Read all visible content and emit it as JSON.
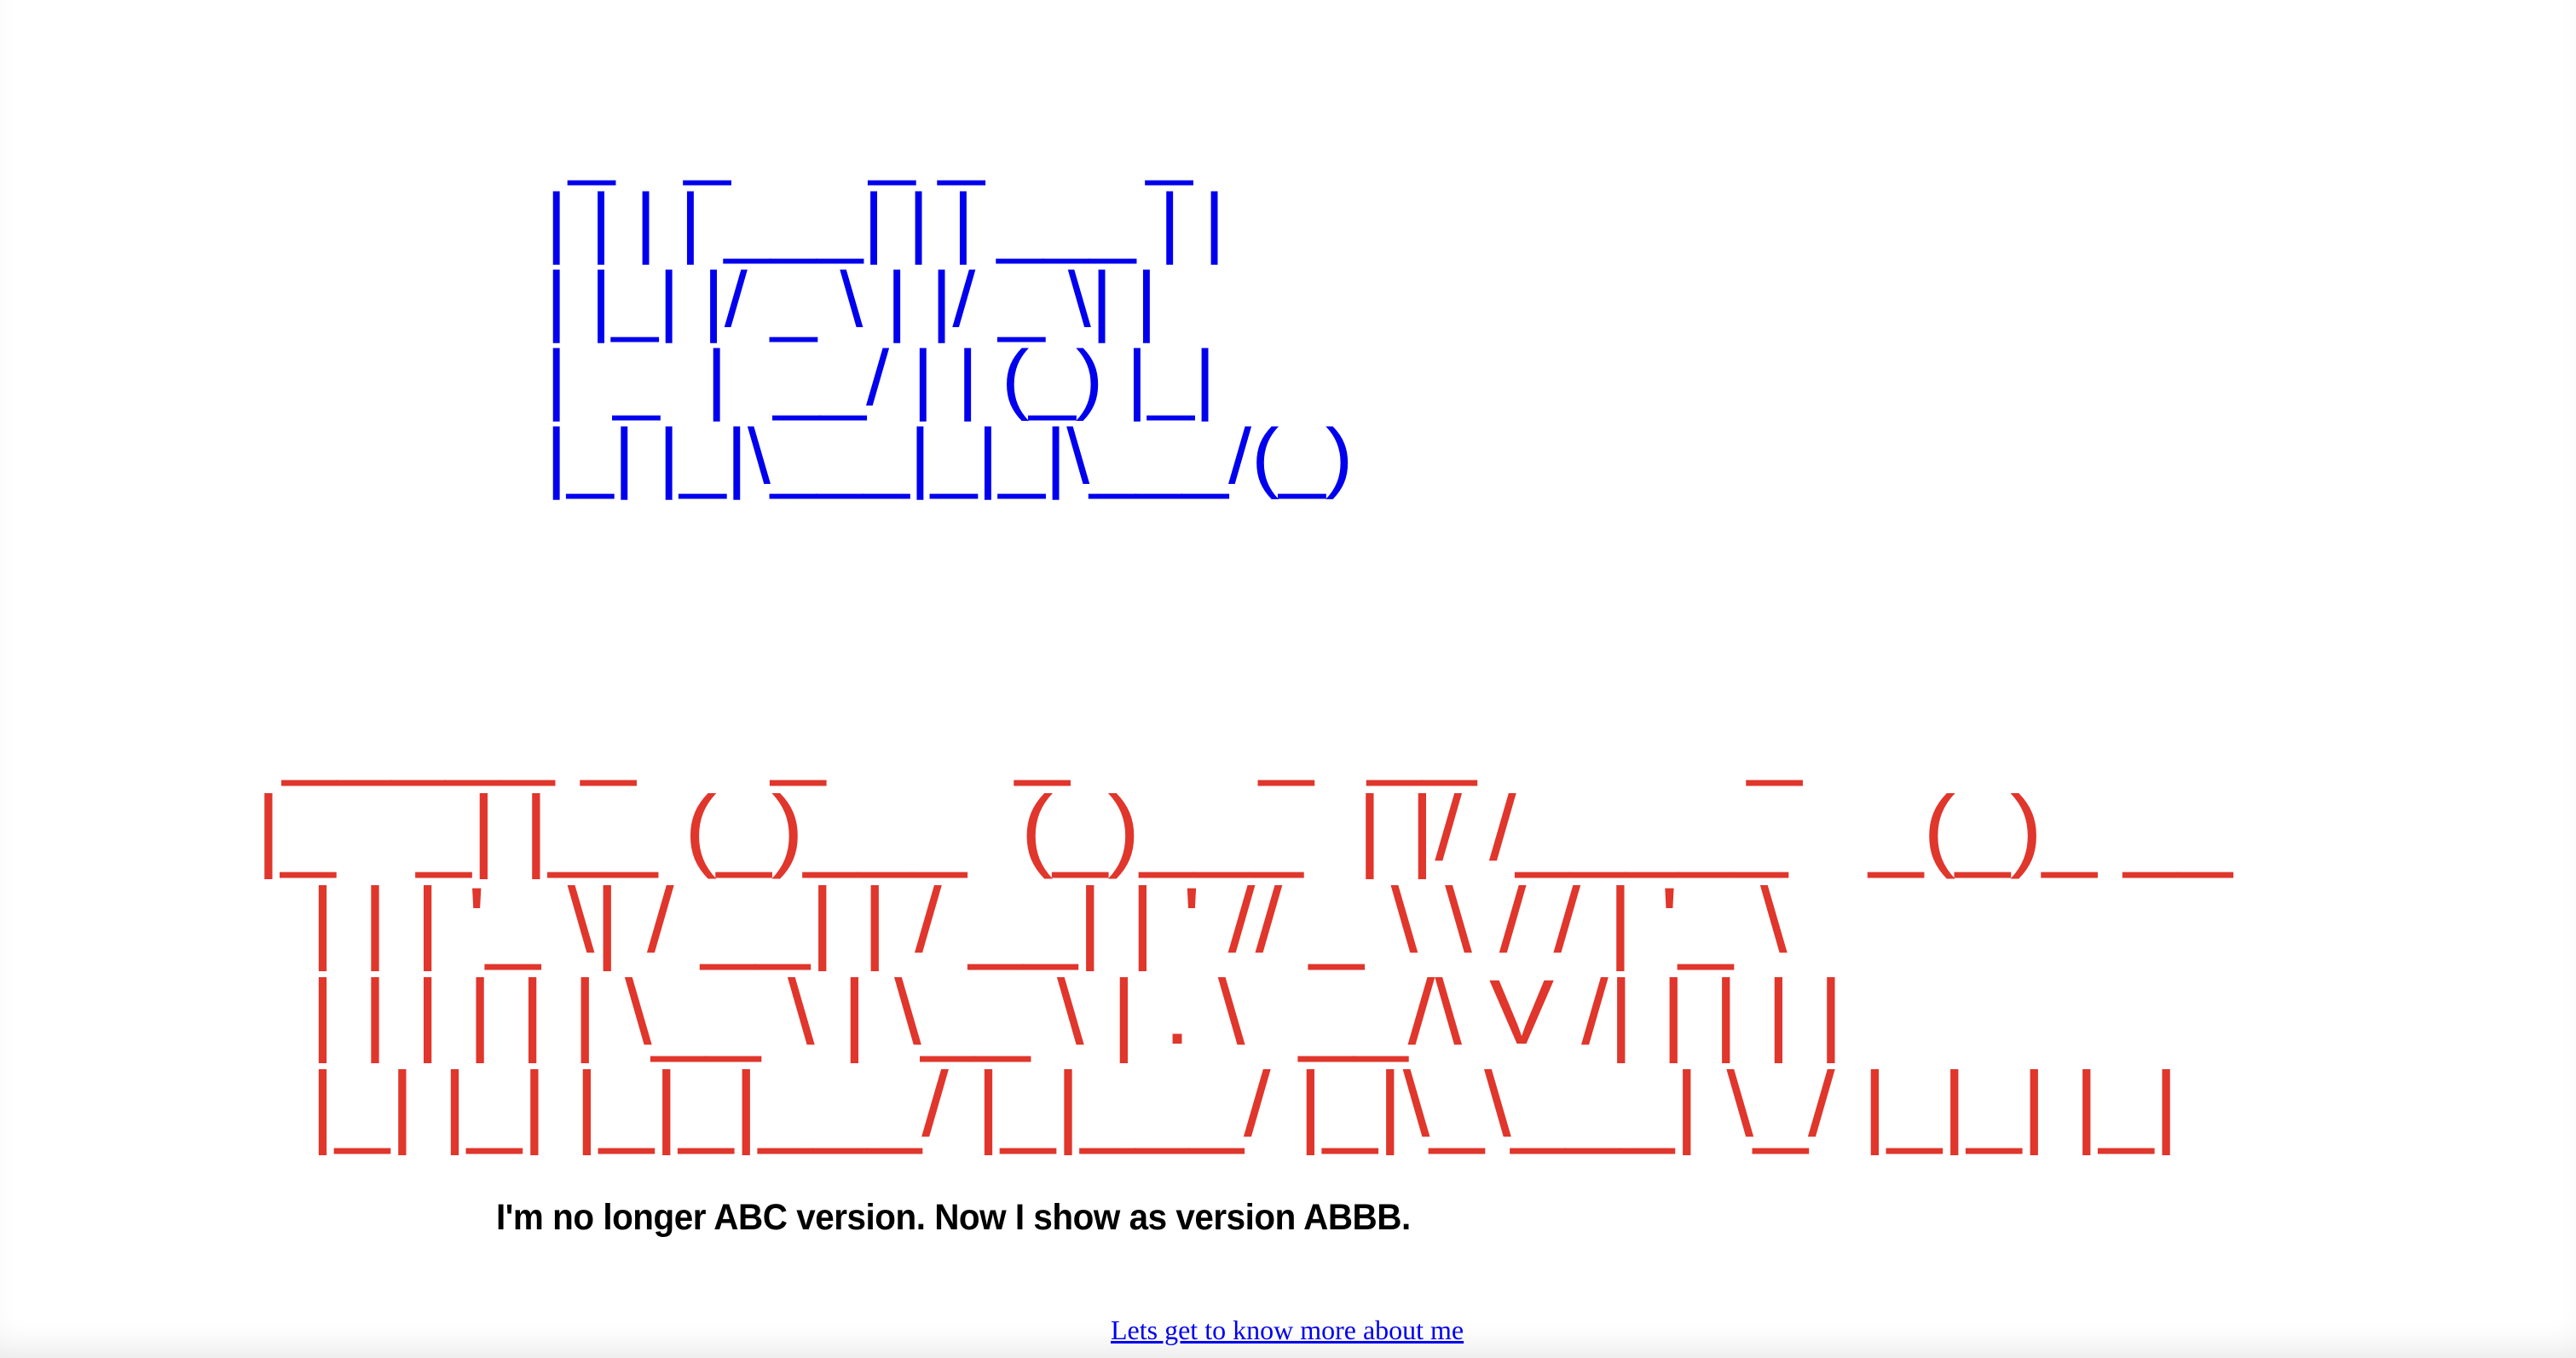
{
  "hello_banner": {
    "color": "#0000ee",
    "ascii": " _   _      _ _       _ \n| | | | ___| | | ___ | |\n| |_| |/ _ \\ | |/ _ \\| |\n|  _  |  __/ | | (_) |_|\n|_| |_|\\___|_|_|\\___/(_)"
  },
  "name_banner": {
    "color": "#e0362c",
    "ascii": " _____ _     _       _       _  __          _       \n|_   _| |__ (_)___  (_)___  | |/ /_____   _(_)_ __  \n  | | | '_ \\| / __| | / __| | ' // _ \\ \\ / / | '_ \\ \n  | | | | | | \\__ \\ | \\__ \\ | . \\  __/\\ V /| | | | |\n  |_| |_| |_|_|___/ |_|___/ |_|\\_\\___| \\_/ |_|_| |_|"
  },
  "message": "I'm no longer ABC version. Now I show as version ABBB.",
  "link": {
    "label": "Lets get to know more about me",
    "color": "#0000ee"
  }
}
